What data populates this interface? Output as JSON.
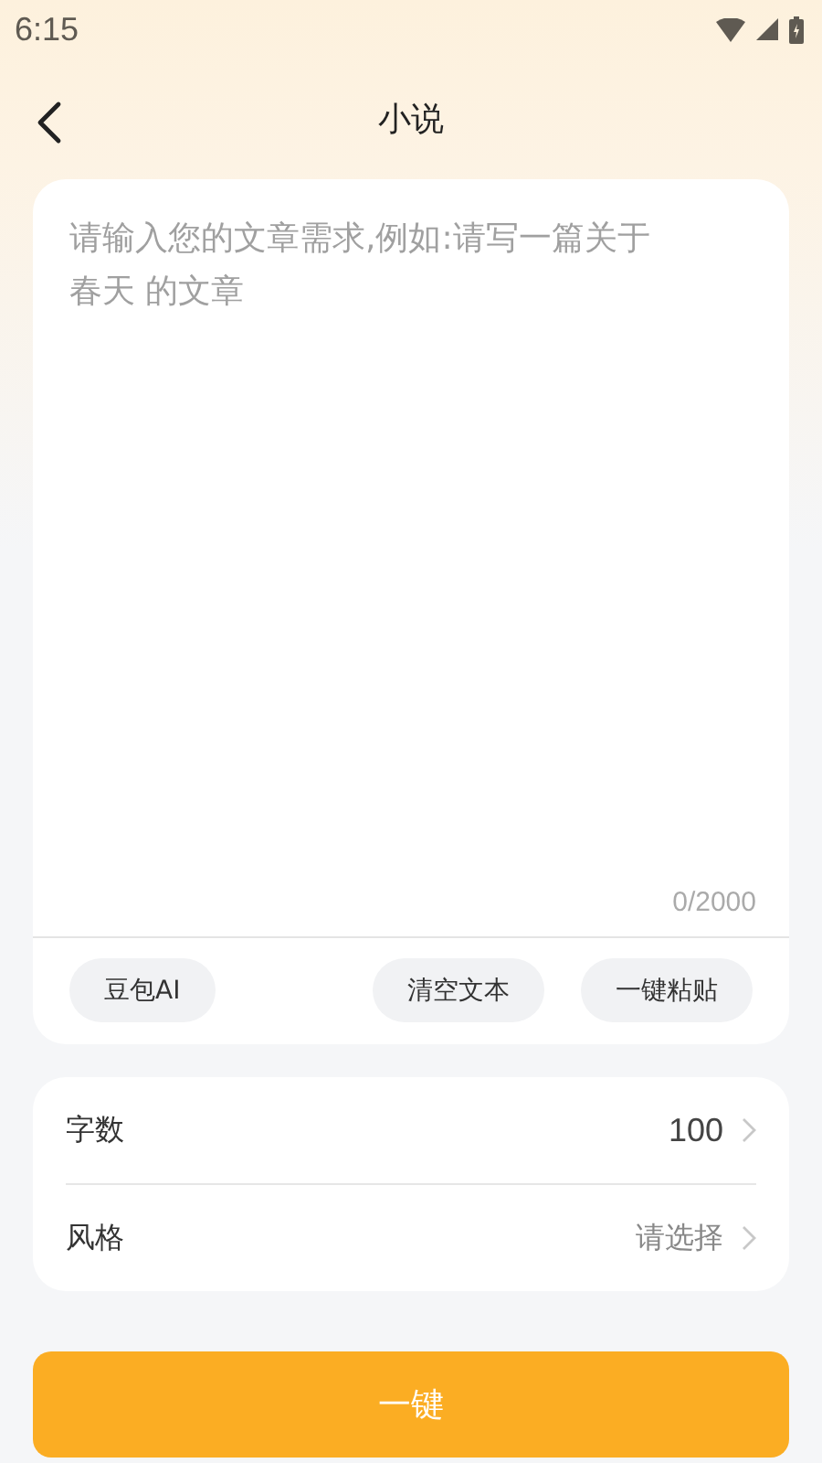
{
  "status_bar": {
    "time": "6:15"
  },
  "header": {
    "title": "小说"
  },
  "editor": {
    "placeholder": "请输入您的文章需求,例如:请写一篇关于春天 的文章",
    "counter": "0/2000"
  },
  "editor_actions_left": [
    {
      "label": "豆包AI"
    }
  ],
  "editor_actions_right": [
    {
      "label": "清空文本"
    },
    {
      "label": "一键粘贴"
    }
  ],
  "settings": [
    {
      "label": "字数",
      "value": "100",
      "kind": "value"
    },
    {
      "label": "风格",
      "value": "请选择",
      "kind": "placeholder"
    }
  ],
  "primary_button": {
    "label": "一键"
  }
}
